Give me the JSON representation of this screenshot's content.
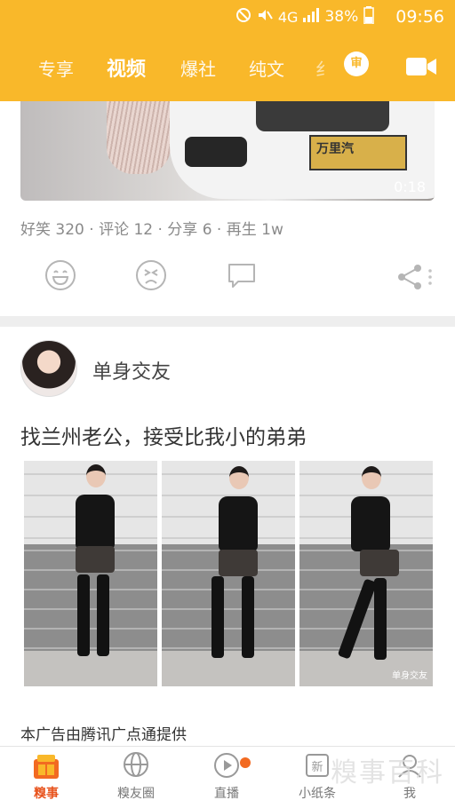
{
  "status": {
    "network": "4G",
    "battery": "38%",
    "time": "09:56",
    "icons": [
      "mute-icon",
      "vibrate-off-icon",
      "signal-icon",
      "battery-icon"
    ]
  },
  "tabs": [
    {
      "label": "专享"
    },
    {
      "label": "视频",
      "active": true
    },
    {
      "label": "爆社"
    },
    {
      "label": "纯文"
    },
    {
      "label": "纟"
    }
  ],
  "review_badge": "审",
  "video": {
    "duration": "0:18",
    "plate_text": "万里汽",
    "stats": "好笑 320 · 评论 12 · 分享 6 · 再生 1w"
  },
  "post": {
    "author": "单身交友",
    "title": "找兰州老公，接受比我小的弟弟",
    "photo_watermark": "单身交友",
    "ad_note": "本广告由腾讯广点通提供"
  },
  "nav": [
    {
      "label": "糗事",
      "icon": "qiushi-icon",
      "active": true
    },
    {
      "label": "糗友圈",
      "icon": "circle-icon"
    },
    {
      "label": "直播",
      "icon": "live-icon",
      "dot": true
    },
    {
      "label": "小纸条",
      "icon": "note-icon"
    },
    {
      "label": "我",
      "icon": "me-icon"
    }
  ],
  "logo_text": "糗事百科",
  "colors": {
    "header": "#F9B82A",
    "active_nav": "#E8541E",
    "badge": "#F26A21"
  }
}
